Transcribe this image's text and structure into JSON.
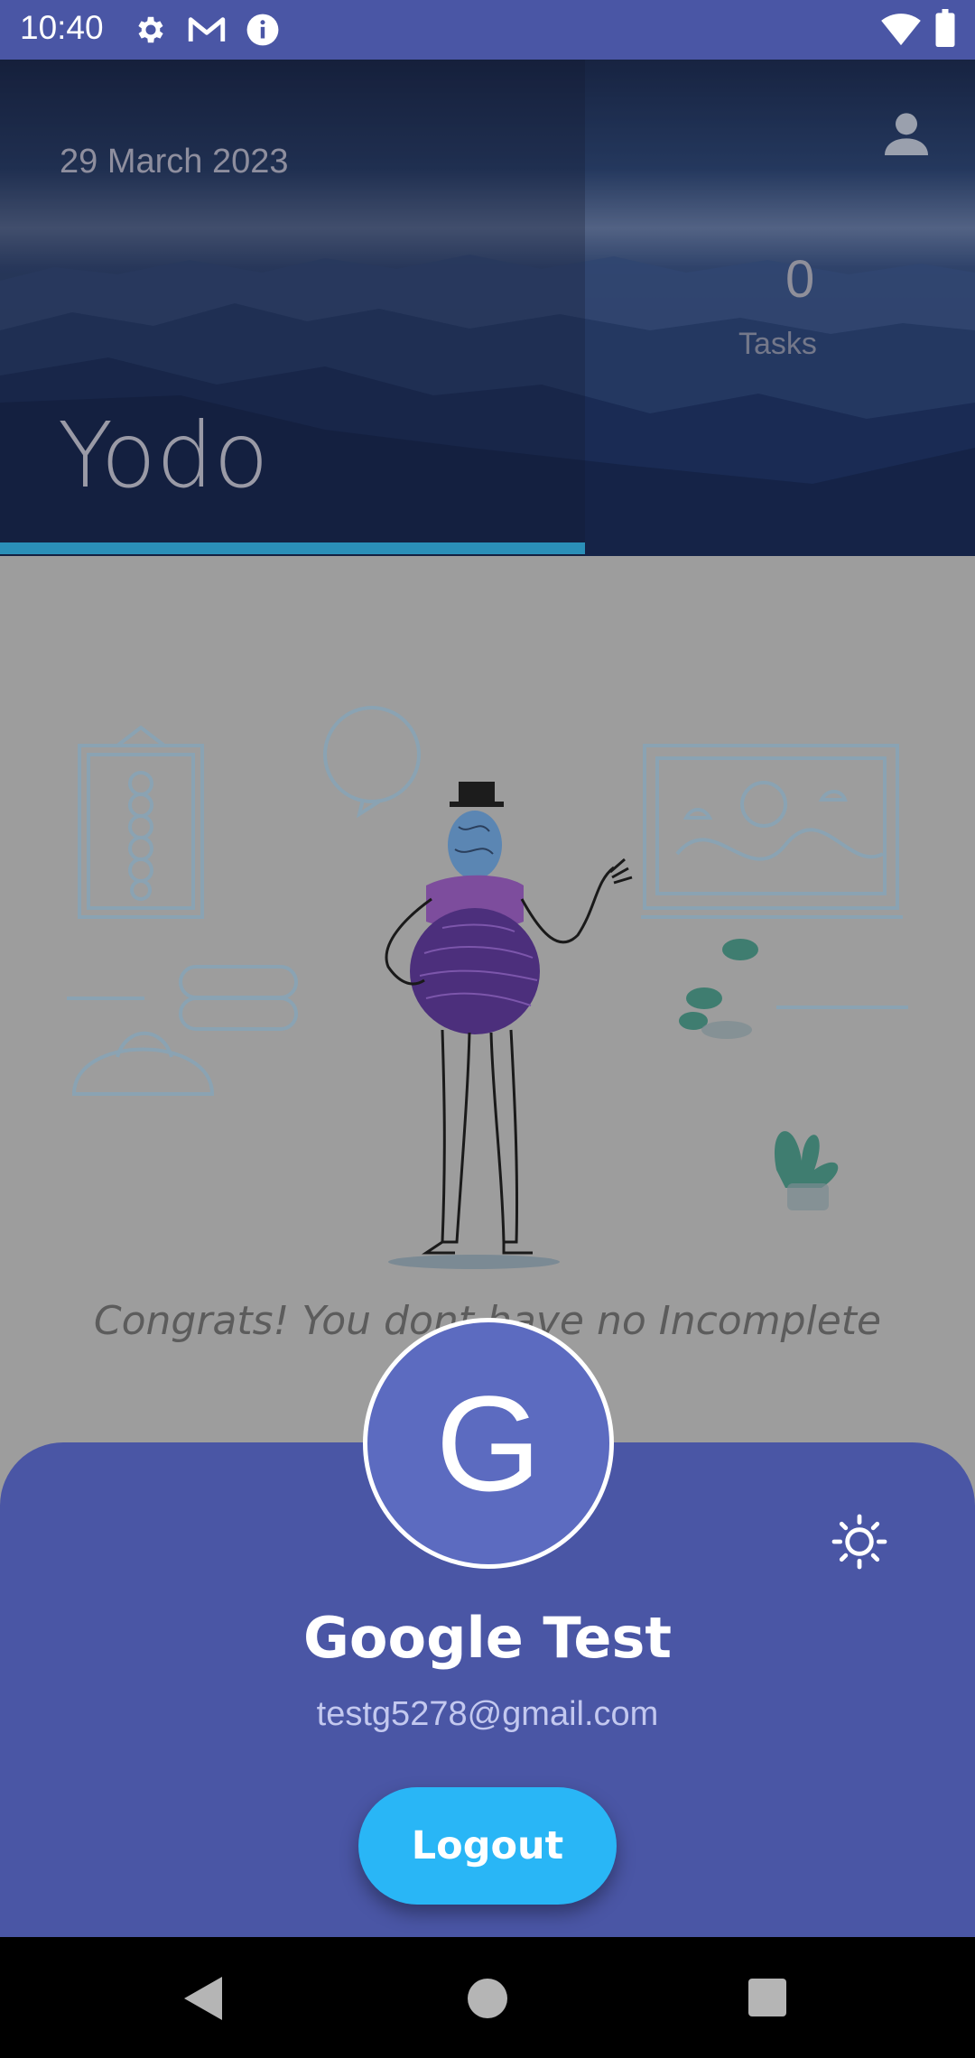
{
  "status_bar": {
    "time": "10:40",
    "left_icons": [
      "gear-icon",
      "gmail-icon",
      "info-icon"
    ],
    "right_icons": [
      "wifi-icon",
      "battery-icon"
    ]
  },
  "header": {
    "date": "29 March 2023",
    "app_title": "Yodo",
    "task_count": "0",
    "task_label": "Tasks",
    "profile_icon": "person-icon"
  },
  "content": {
    "empty_message": "Congrats! You dont have no Incomplete"
  },
  "profile_sheet": {
    "avatar_letter": "G",
    "name": "Google Test",
    "email": "testg5278@gmail.com",
    "logout_label": "Logout",
    "theme_icon": "sun-icon"
  },
  "nav_bar": {
    "buttons": [
      "back-icon",
      "home-icon",
      "recents-icon"
    ]
  },
  "colors": {
    "accent": "#4a56a5",
    "avatar": "#5c6bc0",
    "logout": "#29b6f6"
  }
}
